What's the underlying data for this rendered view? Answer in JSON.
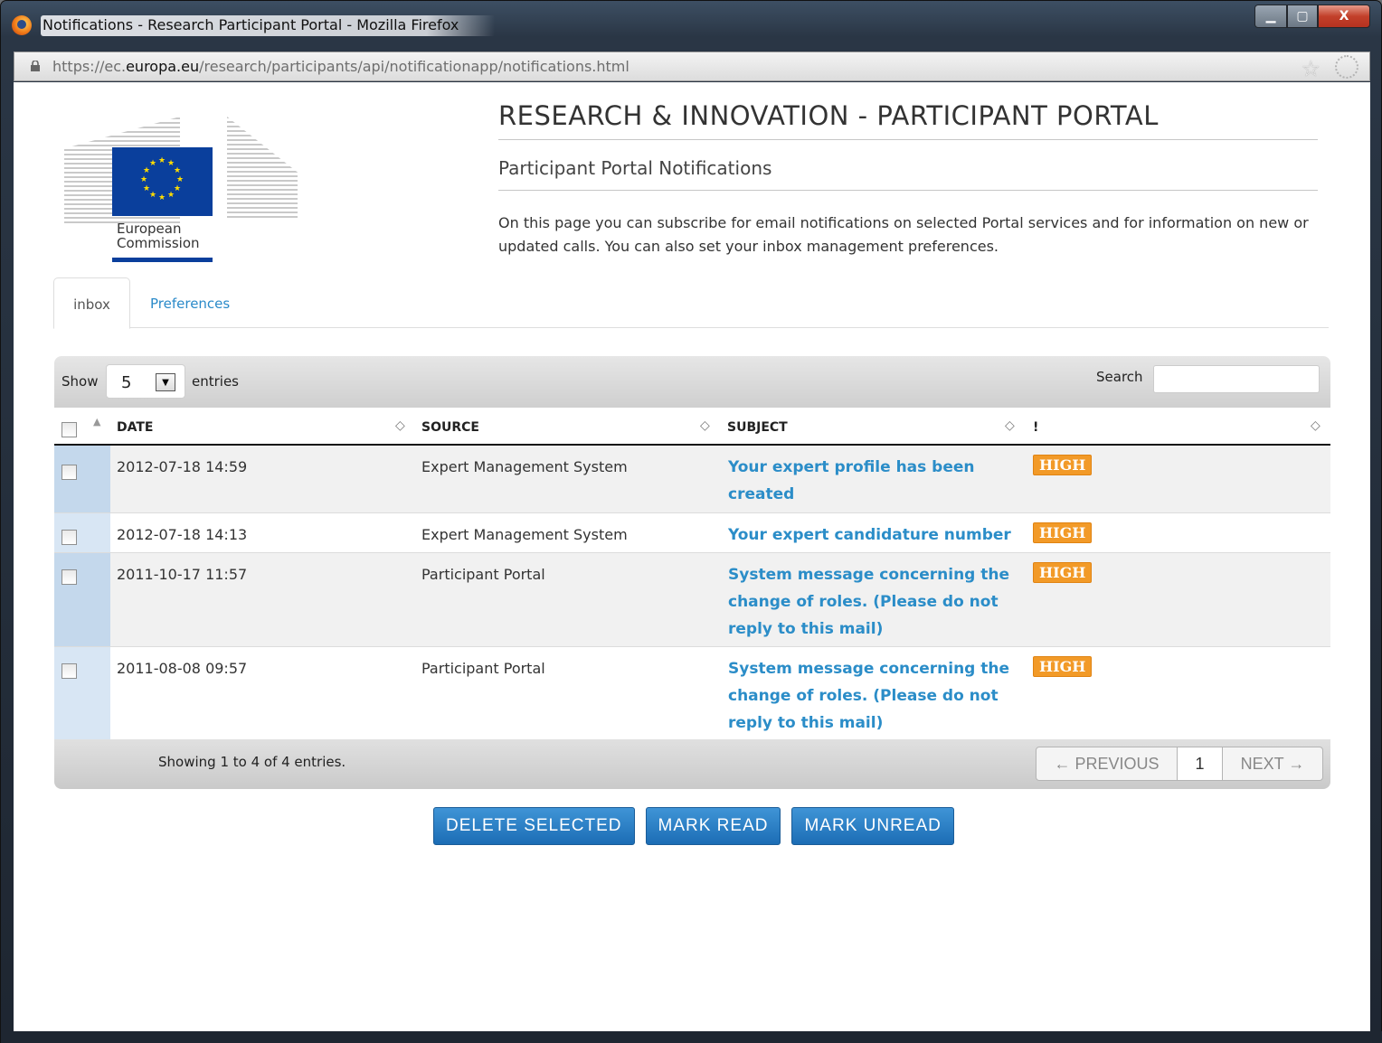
{
  "window": {
    "title": "Notifications - Research Participant Portal - Mozilla Firefox",
    "url_prefix": "https://ec.",
    "url_domain": "europa.eu",
    "url_path": "/research/participants/api/notificationapp/notifications.html",
    "controls": {
      "minimize": "▁",
      "maximize": "▢",
      "close": "X"
    }
  },
  "logo": {
    "name_line1": "European",
    "name_line2": "Commission"
  },
  "header": {
    "title": "RESEARCH & INNOVATION - PARTICIPANT PORTAL",
    "subtitle": "Participant Portal Notifications",
    "intro": "On this page you can subscribe for email notifications on selected Portal services and for information on new or updated calls. You can also set your inbox management preferences."
  },
  "tabs": [
    {
      "label": "inbox",
      "active": true
    },
    {
      "label": "Preferences",
      "active": false
    }
  ],
  "table": {
    "show_label": "Show",
    "page_length": "5",
    "entries_label": "entries",
    "search_label": "Search",
    "search_value": "",
    "columns": {
      "date": "DATE",
      "source": "SOURCE",
      "subject": "SUBJECT",
      "priority": "!"
    },
    "rows": [
      {
        "date": "2012-07-18 14:59",
        "source": "Expert Management System",
        "subject": "Your expert profile has been created",
        "priority": "HIGH"
      },
      {
        "date": "2012-07-18 14:13",
        "source": "Expert Management System",
        "subject": "Your expert candidature number",
        "priority": "HIGH"
      },
      {
        "date": "2011-10-17 11:57",
        "source": "Participant Portal",
        "subject": "System message concerning the change of roles. (Please do not reply to this mail)",
        "priority": "HIGH"
      },
      {
        "date": "2011-08-08 09:57",
        "source": "Participant Portal",
        "subject": "System message concerning the change of roles. (Please do not reply to this mail)",
        "priority": "HIGH"
      }
    ],
    "info": "Showing 1 to 4 of 4 entries.",
    "pager": {
      "previous": "← PREVIOUS",
      "current": "1",
      "next": "NEXT →"
    }
  },
  "actions": {
    "delete": "DELETE SELECTED",
    "mark_read": "MARK READ",
    "mark_unread": "MARK UNREAD"
  },
  "colors": {
    "accent": "#2b8dc8",
    "badge": "#f29a28",
    "eu_blue": "#0a3f9c",
    "button": "#2a7fc4"
  }
}
